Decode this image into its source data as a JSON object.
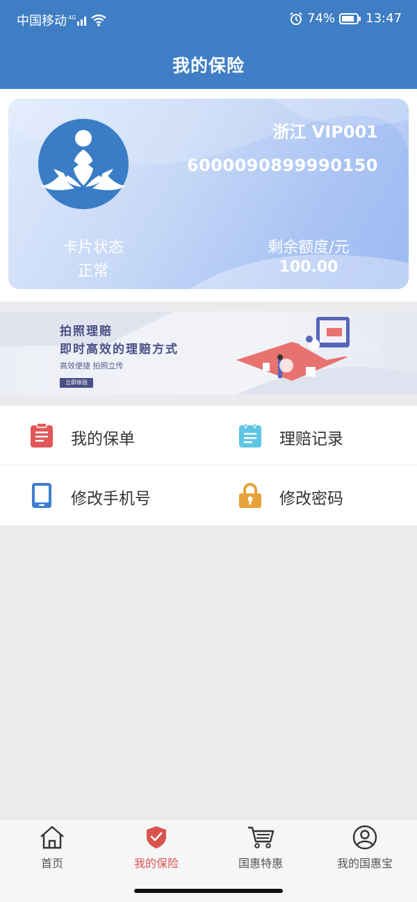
{
  "status_bar": {
    "carrier": "中国移动",
    "network": "4G",
    "battery": "74%",
    "time": "13:47"
  },
  "header": {
    "title": "我的保险"
  },
  "card": {
    "name": "浙江 VIP001",
    "number": "6000090899990150",
    "status_label": "卡片状态",
    "status_value": "正常",
    "balance_label": "剩余额度/元",
    "balance_value": "100.00"
  },
  "banner": {
    "title_line1": "拍照理赔",
    "title_line2": "即时高效的理赔方式",
    "subtitle": "高效便捷  拍照立传",
    "button": "立即体验"
  },
  "menu": {
    "items": [
      {
        "label": "我的保单",
        "icon": "clipboard-icon",
        "color": "#e2585a"
      },
      {
        "label": "理赔记录",
        "icon": "notepad-icon",
        "color": "#5ec6e4"
      },
      {
        "label": "修改手机号",
        "icon": "phone-icon",
        "color": "#3d7fd0"
      },
      {
        "label": "修改密码",
        "icon": "lock-icon",
        "color": "#e8a23a"
      }
    ]
  },
  "tab_bar": {
    "tabs": [
      {
        "label": "首页",
        "icon": "home-icon"
      },
      {
        "label": "我的保险",
        "icon": "shield-icon",
        "active": true
      },
      {
        "label": "国惠特惠",
        "icon": "cart-icon"
      },
      {
        "label": "我的国惠宝",
        "icon": "user-icon"
      }
    ]
  },
  "colors": {
    "brand": "#3f7ec4",
    "active_tab": "#d9534f"
  }
}
